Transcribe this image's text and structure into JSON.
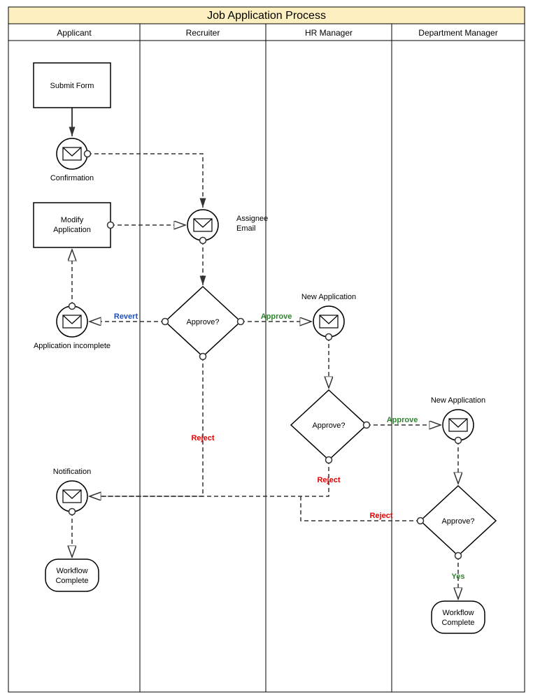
{
  "title": "Job Application Process",
  "lanes": {
    "applicant": "Applicant",
    "recruiter": "Recruiter",
    "hr": "HR Manager",
    "dept": "Department Manager"
  },
  "nodes": {
    "submit": "Submit Form",
    "confirmation": "Confirmation",
    "modify1": "Modify",
    "modify2": "Application",
    "appIncomplete": "Application incomplete",
    "assignee1": "Assignee",
    "assignee2": "Email",
    "approve1": "Approve?",
    "newApp1": "New Application",
    "approve2": "Approve?",
    "newApp2": "New Application",
    "approve3": "Approve?",
    "notification": "Notification",
    "wfc1a": "Workflow",
    "wfc1b": "Complete",
    "wfc2a": "Workflow",
    "wfc2b": "Complete"
  },
  "labels": {
    "revert": "Revert",
    "approve1": "Approve",
    "reject1": "Reject",
    "approve2": "Approve",
    "reject2": "Reject",
    "reject3": "Reject",
    "yes": "Yes"
  },
  "colors": {
    "titleBg": "#FDEFBF",
    "approve": "#2D862D",
    "reject": "#E60000",
    "revert": "#1F4FB5"
  }
}
